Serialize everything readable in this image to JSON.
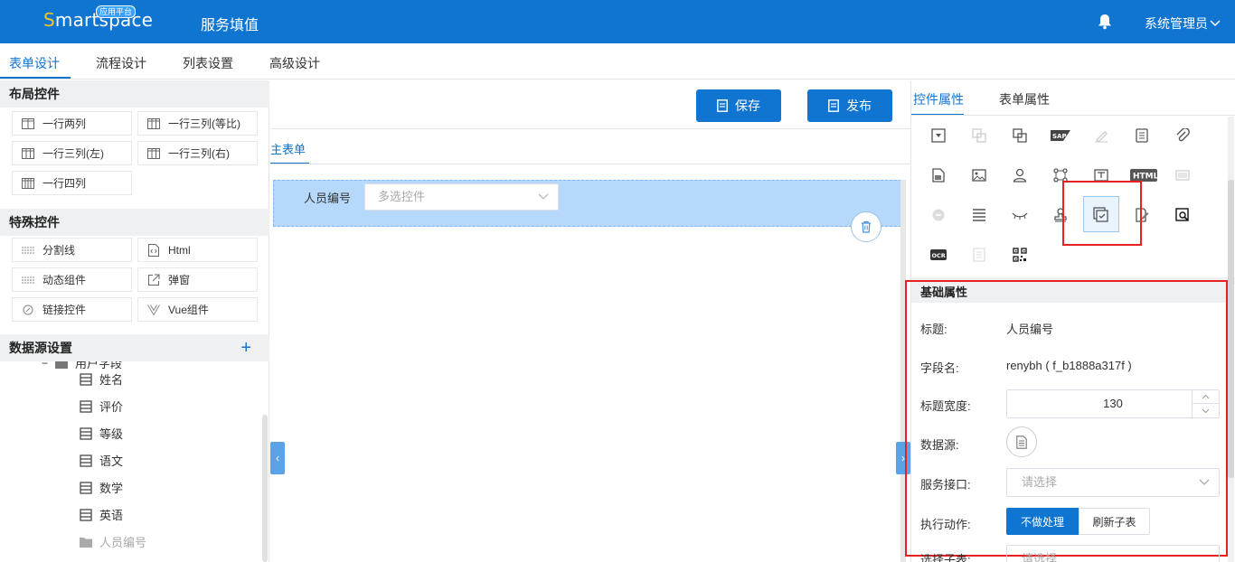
{
  "header": {
    "logo_text_s": "S",
    "logo_text_rest": "martspace",
    "logo_badge": "应用平台",
    "title": "服务填值",
    "user": "系统管理员"
  },
  "top_tabs": [
    "表单设计",
    "流程设计",
    "列表设置",
    "高级设计"
  ],
  "left": {
    "layout_title": "布局控件",
    "layout_controls": [
      "一行两列",
      "一行三列(等比)",
      "一行三列(左)",
      "一行三列(右)",
      "一行四列"
    ],
    "special_title": "特殊控件",
    "special_controls": [
      "分割线",
      "Html",
      "动态组件",
      "弹窗",
      "链接控件",
      "Vue组件"
    ],
    "datasource_title": "数据源设置",
    "datasource_add": "+",
    "tree_partial": "用户字段",
    "tree_items": [
      "姓名",
      "评价",
      "等级",
      "语文",
      "数学",
      "英语",
      "人员编号"
    ]
  },
  "center": {
    "save_label": "保存",
    "publish_label": "发布",
    "sub_tab": "主表单",
    "field_label": "人员编号",
    "field_placeholder": "多选控件"
  },
  "right": {
    "tabs": [
      "控件属性",
      "表单属性"
    ],
    "html_icon_text": "HTML",
    "sap_icon_text": "SAP",
    "ocr_icon_text": "OCR",
    "section_title": "基础属性",
    "title_label": "标题:",
    "title_value": "人员编号",
    "field_label": "字段名:",
    "field_value": "renybh ( f_b1888a317f )",
    "width_label": "标题宽度:",
    "width_value": "130",
    "datasource_label": "数据源:",
    "service_label": "服务接口:",
    "service_placeholder": "请选择",
    "action_label": "执行动作:",
    "action_options": [
      "不做处理",
      "刷新子表"
    ],
    "cut_label": "选择子表:",
    "cut_placeholder": "请选择"
  },
  "colors": {
    "primary": "#0f75d1",
    "highlight_box": "#e82020",
    "selected_row": "#b5d8fb"
  }
}
